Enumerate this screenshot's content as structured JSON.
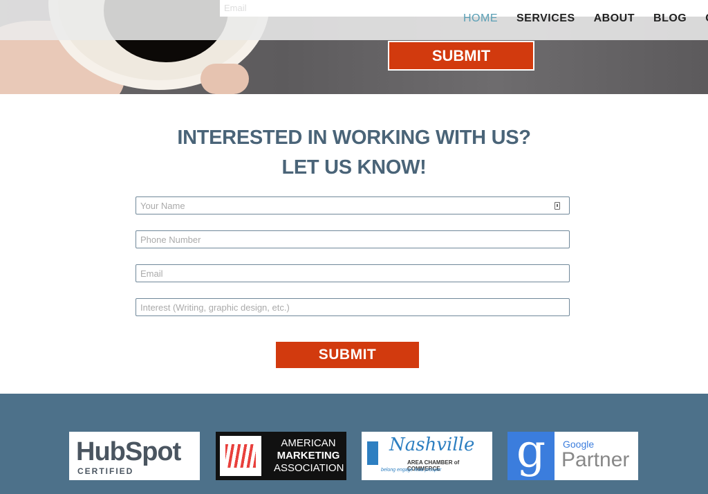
{
  "header": {
    "email_placeholder": "Email",
    "nav": [
      "HOME",
      "SERVICES",
      "ABOUT",
      "BLOG",
      "CO"
    ],
    "active": "HOME",
    "submit": "SUBMIT"
  },
  "form": {
    "heading_line1": "INTERESTED IN WORKING WITH US?",
    "heading_line2": "LET US KNOW!",
    "fields": [
      {
        "placeholder": "Your Name"
      },
      {
        "placeholder": "Phone Number"
      },
      {
        "placeholder": "Email"
      },
      {
        "placeholder": "Interest (Writing, graphic design, etc.)"
      }
    ],
    "submit": "SUBMIT"
  },
  "footer": {
    "logos": [
      {
        "name": "HubSpot",
        "sub": "CERTIFIED"
      },
      {
        "name": "AMERICAN MARKETING ASSOCIATION",
        "lines": [
          "AMERICAN",
          "MARKETING",
          "ASSOCIATION"
        ]
      },
      {
        "name": "Nashville",
        "sub": "AREA CHAMBER of COMMERCE",
        "tag": "belong engage lead prosper"
      },
      {
        "name": "Google Partner",
        "brand": "Google",
        "sub": "Partner"
      }
    ]
  },
  "colors": {
    "accent": "#d23a0e",
    "heading": "#4a6478",
    "footer": "#4d718a",
    "nav_active": "#5a9fb5"
  }
}
